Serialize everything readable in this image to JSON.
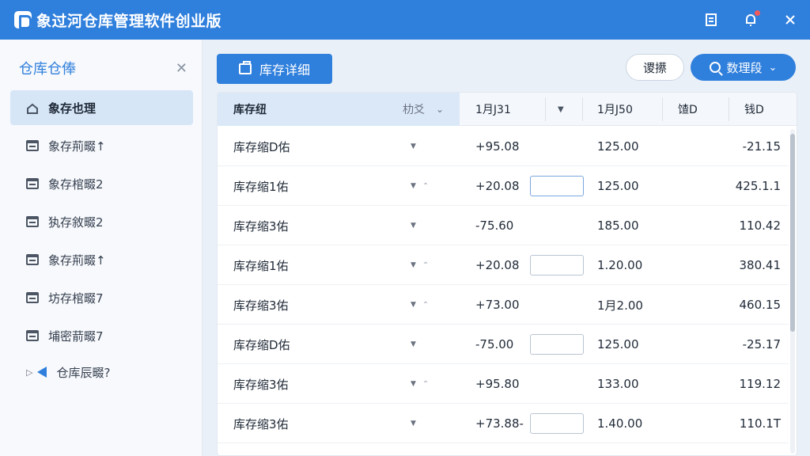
{
  "app": {
    "title": "象过河仓库管理软件创业版"
  },
  "titlebar": {
    "icons": [
      "document-icon",
      "bell-icon",
      "close-icon"
    ]
  },
  "sidebar": {
    "title": "仓库仓俸",
    "items": [
      {
        "label": "象存也理",
        "icon": "home-icon",
        "active": true
      },
      {
        "label": "象存荊畷↑",
        "icon": "box-icon"
      },
      {
        "label": "象存棺畷2",
        "icon": "box-icon"
      },
      {
        "label": "犱存敘畷2",
        "icon": "box-icon"
      },
      {
        "label": "象存荊畷↑",
        "icon": "box-icon"
      },
      {
        "label": "坊存棺畷7",
        "icon": "box-icon"
      },
      {
        "label": "埔密葥畷7",
        "icon": "box-icon"
      },
      {
        "label": "仓库辰畷?",
        "icon": "triangle-icon",
        "expandable": true
      }
    ]
  },
  "toolbar": {
    "primary_label": "库存详细",
    "outline_label": "谡攃",
    "pill_label": "数理段"
  },
  "table": {
    "headers": [
      "库存纽",
      "朸爻",
      "1月Ј31",
      "1月Ј50",
      "馇D",
      "钱D"
    ],
    "rows": [
      {
        "name": "库存缩D佑",
        "a": "+95.08",
        "b": "125.00",
        "c": "-21.15",
        "up": false,
        "input": false
      },
      {
        "name": "库存缩1佑",
        "a": "+20.08",
        "b": "125.00",
        "c": "425.1.1",
        "up": true,
        "input": true,
        "focus": true
      },
      {
        "name": "库存缩3佑",
        "a": "-75.60",
        "b": "185.00",
        "c": "110.42",
        "up": false,
        "input": false
      },
      {
        "name": "库存缩1佑",
        "a": "+20.08",
        "b": "1.20.00",
        "c": "380.41",
        "up": true,
        "input": true
      },
      {
        "name": "库存缩3佑",
        "a": "+73.00",
        "b": "1月2.00",
        "c": "460.15",
        "up": true,
        "input": false
      },
      {
        "name": "库存缩D佑",
        "a": "-75.00",
        "b": "125.00",
        "c": "-25.17",
        "up": false,
        "input": true
      },
      {
        "name": "库存缩3佑",
        "a": "+95.80",
        "b": "133.00",
        "c": "119.12",
        "up": true,
        "input": false
      },
      {
        "name": "库存缩3佑",
        "a": "+73.88-",
        "b": "1.40.00",
        "c": "110.1T",
        "up": false,
        "input": true
      }
    ]
  }
}
